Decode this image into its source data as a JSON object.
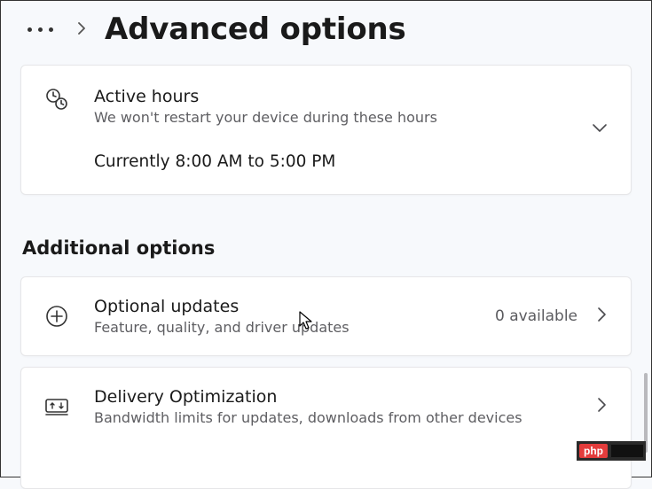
{
  "header": {
    "title": "Advanced options"
  },
  "cards": {
    "activeHours": {
      "title": "Active hours",
      "subtitle": "We won't restart your device during these hours",
      "status": "Currently 8:00 AM to 5:00 PM"
    },
    "optionalUpdates": {
      "title": "Optional updates",
      "subtitle": "Feature, quality, and driver updates",
      "count": "0 available"
    },
    "deliveryOptimization": {
      "title": "Delivery Optimization",
      "subtitle": "Bandwidth limits for updates, downloads from other devices"
    }
  },
  "section": {
    "additional": "Additional options"
  },
  "watermark": {
    "label": "php"
  }
}
